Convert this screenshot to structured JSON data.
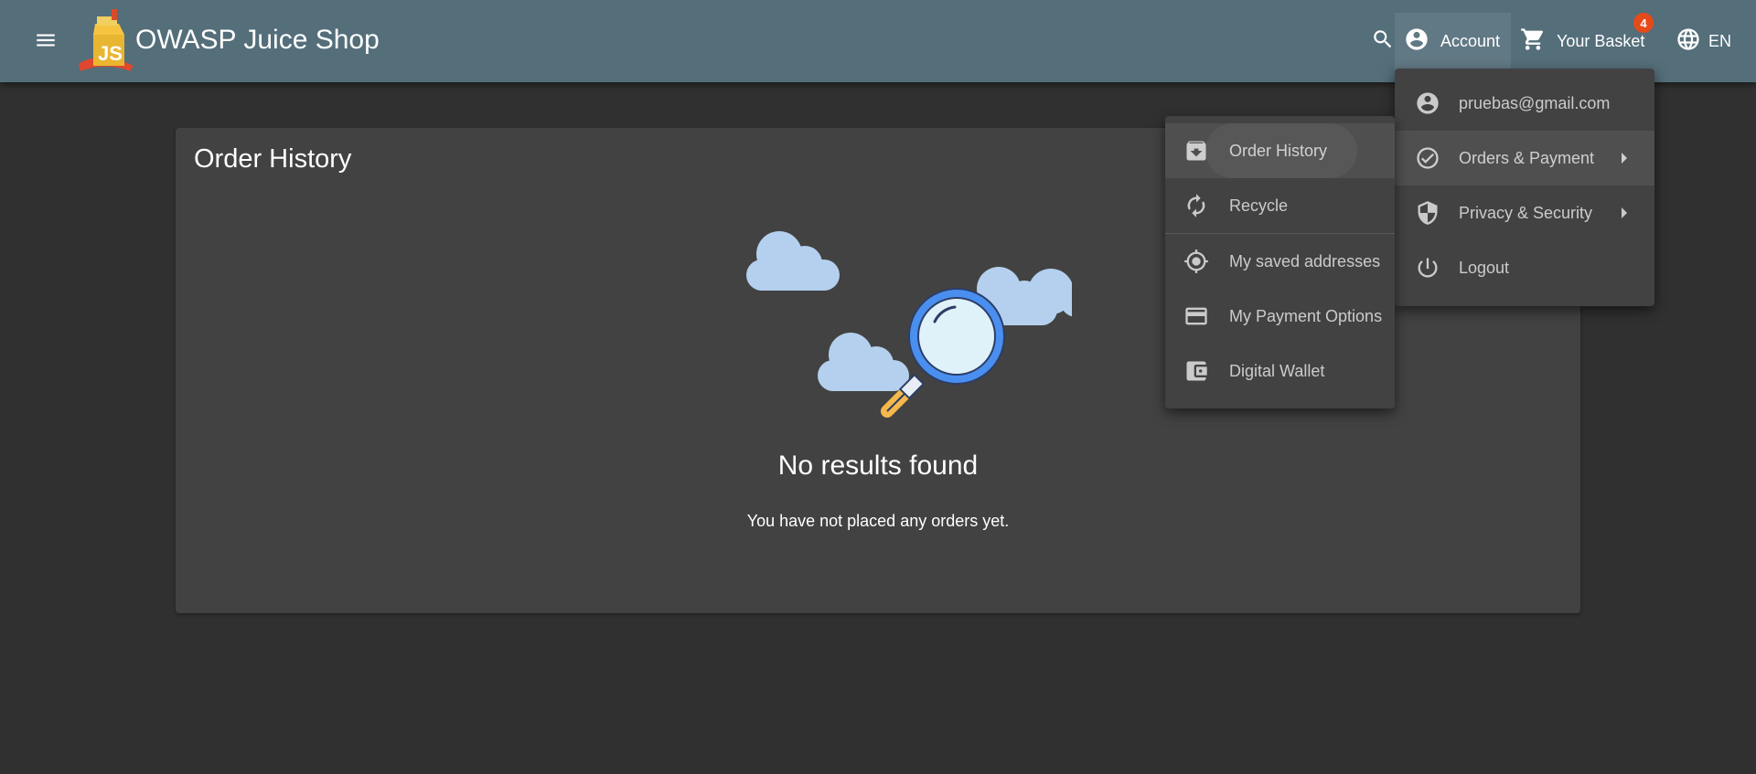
{
  "header": {
    "app_title": "OWASP Juice Shop",
    "account_label": "Account",
    "basket_label": "Your Basket",
    "basket_count": "4",
    "language_label": "EN"
  },
  "page": {
    "title": "Order History",
    "empty_title": "No results found",
    "empty_message": "You have not placed any orders yet."
  },
  "account_menu": {
    "email": "pruebas@gmail.com",
    "orders_payment": "Orders & Payment",
    "privacy_security": "Privacy & Security",
    "logout": "Logout"
  },
  "orders_submenu": {
    "order_history": "Order History",
    "recycle": "Recycle",
    "saved_addresses": "My saved addresses",
    "payment_options": "My Payment Options",
    "digital_wallet": "Digital Wallet"
  },
  "colors": {
    "toolbar": "#546e7a",
    "background": "#303030",
    "card": "#424242",
    "badge": "#e64a19"
  }
}
